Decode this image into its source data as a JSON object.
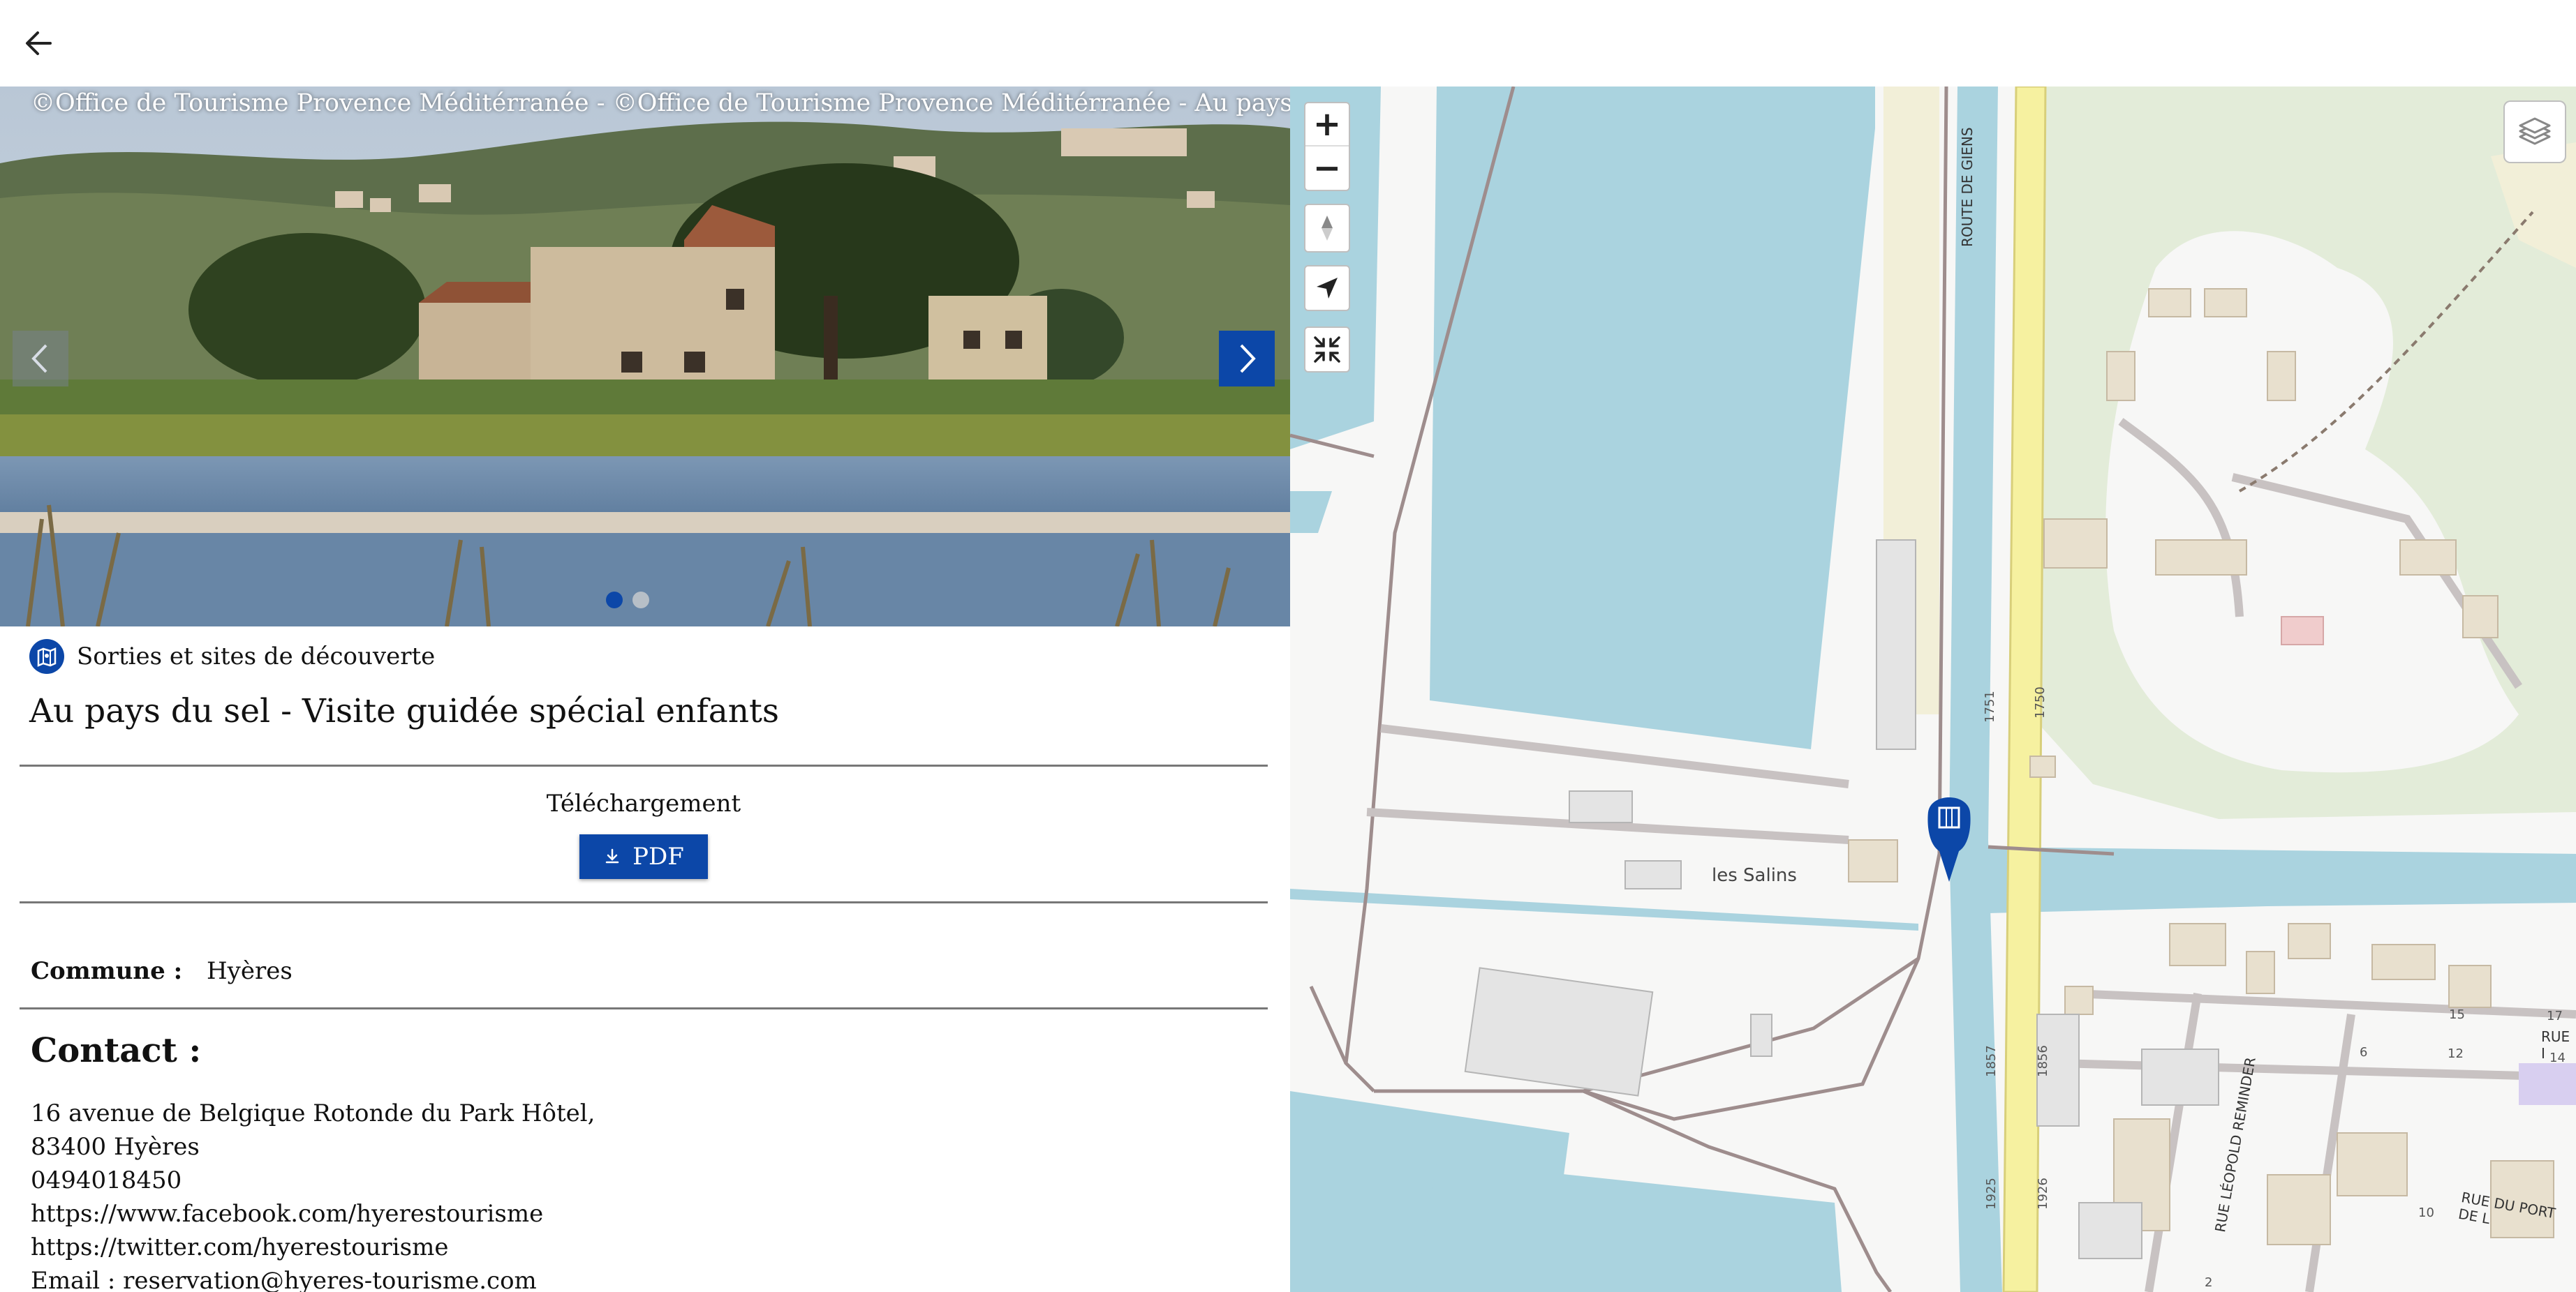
{
  "header": {
    "back_icon": "arrow-left-icon"
  },
  "carousel": {
    "credit": "©Office de Tourisme Provence Méditérranée - ©Office de Tourisme Provence Méditérranée - Au pays du sel",
    "prev_icon": "chevron-left-icon",
    "next_icon": "chevron-right-icon",
    "slide_count": 2,
    "active_slide": 1
  },
  "category": {
    "label": "Sorties et sites de découverte",
    "icon": "map-guide-icon"
  },
  "title": "Au pays du sel - Visite guidée spécial enfants",
  "download": {
    "label": "Téléchargement",
    "button_label": "PDF",
    "icon": "download-icon"
  },
  "commune": {
    "label": "Commune :",
    "value": "Hyères"
  },
  "contact": {
    "heading": "Contact :",
    "lines": [
      "16 avenue de Belgique Rotonde du Park Hôtel,",
      "83400 Hyères",
      "0494018450",
      "https://www.facebook.com/hyerestourisme",
      "https://twitter.com/hyerestourisme",
      "Email : reservation@hyeres-tourisme.com"
    ]
  },
  "map": {
    "zoom_in": "+",
    "zoom_out": "−",
    "place_label": "les Salins",
    "road_labels": {
      "route_giens": "ROUTE DE GIENS",
      "rue_leopold": "RUE LÉOPOLD REMINDER",
      "rue_port": "RUE DU PORT DE L",
      "rue_short": "RUE I",
      "n1751": "1751",
      "n1750": "1750",
      "n1857": "1857",
      "n1856": "1856",
      "n1925": "1925",
      "n1926": "1926",
      "n15": "15",
      "n17": "17",
      "n14": "14",
      "n12": "12",
      "n10": "10",
      "n6": "6",
      "n2": "2"
    },
    "colors": {
      "water": "#aad3df",
      "land": "#f7f7f6",
      "park": "#e3ecd9",
      "sand": "#f2efd8",
      "road_yellow": "#f6f1a0",
      "building": "#e8e0ce",
      "marker": "#0c47a8"
    }
  },
  "colors": {
    "primary": "#0c47a8"
  }
}
